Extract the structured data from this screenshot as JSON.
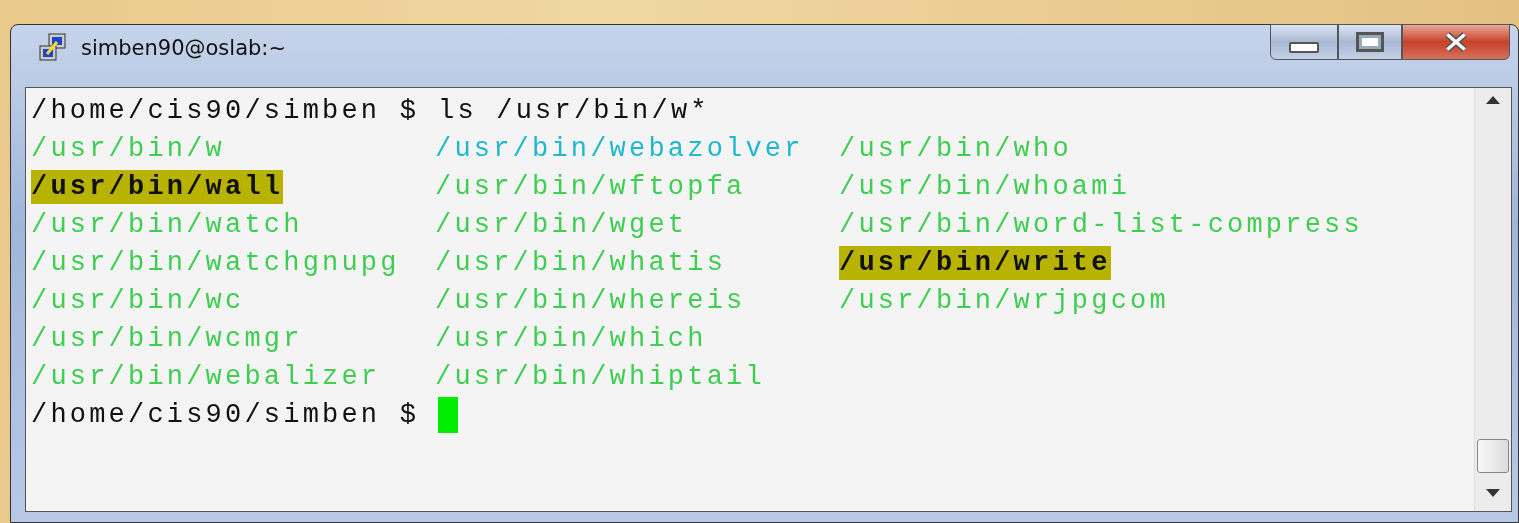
{
  "window": {
    "title": "simben90@oslab:~"
  },
  "terminal": {
    "command_line": {
      "prompt": "/home/cis90/simben $",
      "command": "ls /usr/bin/w*"
    },
    "listing": [
      [
        {
          "text": "/usr/bin/w",
          "kind": "exec"
        },
        {
          "text": "/usr/bin/wall",
          "kind": "setgid"
        },
        {
          "text": "/usr/bin/watch",
          "kind": "exec"
        },
        {
          "text": "/usr/bin/watchgnupg",
          "kind": "exec"
        },
        {
          "text": "/usr/bin/wc",
          "kind": "exec"
        },
        {
          "text": "/usr/bin/wcmgr",
          "kind": "exec"
        },
        {
          "text": "/usr/bin/webalizer",
          "kind": "exec"
        }
      ],
      [
        {
          "text": "/usr/bin/webazolver",
          "kind": "link"
        },
        {
          "text": "/usr/bin/wftopfa",
          "kind": "exec"
        },
        {
          "text": "/usr/bin/wget",
          "kind": "exec"
        },
        {
          "text": "/usr/bin/whatis",
          "kind": "exec"
        },
        {
          "text": "/usr/bin/whereis",
          "kind": "exec"
        },
        {
          "text": "/usr/bin/which",
          "kind": "exec"
        },
        {
          "text": "/usr/bin/whiptail",
          "kind": "exec"
        }
      ],
      [
        {
          "text": "/usr/bin/who",
          "kind": "exec"
        },
        {
          "text": "/usr/bin/whoami",
          "kind": "exec"
        },
        {
          "text": "/usr/bin/word-list-compress",
          "kind": "exec"
        },
        {
          "text": "/usr/bin/write",
          "kind": "setgid"
        },
        {
          "text": "/usr/bin/wrjpgcom",
          "kind": "exec"
        }
      ]
    ],
    "prompt_line": {
      "prompt": "/home/cis90/simben $"
    }
  }
}
